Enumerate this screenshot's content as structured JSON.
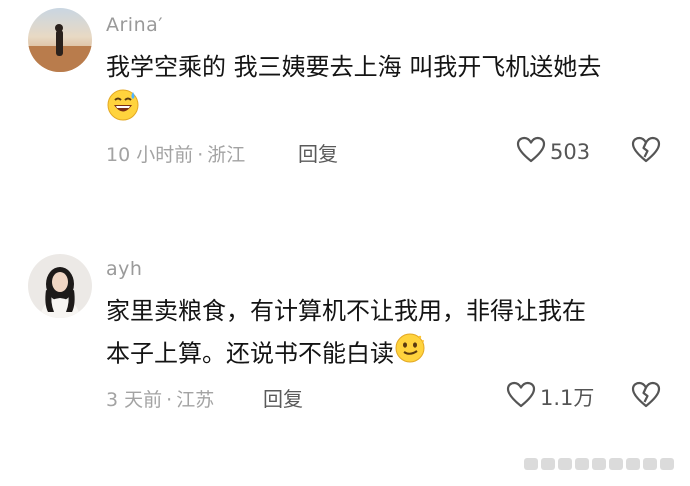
{
  "comments": [
    {
      "username": "Arina′",
      "text": "我学空乘的 我三姨要去上海 叫我开飞机送她去",
      "emoji": "sweat-smile-emoji",
      "time": "10 小时前",
      "location": "浙江",
      "reply_label": "回复",
      "like_count": "503"
    },
    {
      "username": "ayh",
      "text_line1": "家里卖粮食，有计算机不让我用，非得让我在",
      "text_line2": "本子上算。还说书不能白读",
      "emoji": "smirk-emoji",
      "time": "3 天前",
      "location": "江苏",
      "reply_label": "回复",
      "like_count": "1.1万"
    }
  ],
  "separator": "·",
  "colors": {
    "text": "#141414",
    "meta": "#a3a3a3",
    "username": "#9a9a9a",
    "icon": "#555555"
  }
}
